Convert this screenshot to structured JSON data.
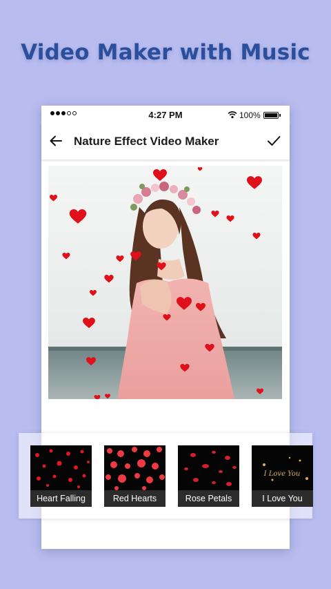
{
  "headline": "Video Maker with Music",
  "status_bar": {
    "time": "4:27 PM",
    "battery": "100%"
  },
  "app_bar": {
    "title": "Nature Effect Video Maker",
    "back_icon": "arrow-left-icon",
    "confirm_icon": "checkmark-icon"
  },
  "preview": {
    "effect_applied": "Heart Falling"
  },
  "effects": [
    {
      "label": "Heart Falling"
    },
    {
      "label": "Red Hearts"
    },
    {
      "label": "Rose Petals"
    },
    {
      "label": "I Love You",
      "overlay_text": "I Love You"
    }
  ],
  "colors": {
    "background": "#b8bcef",
    "headline": "#2b4f9c",
    "heart": "#e0101a"
  }
}
